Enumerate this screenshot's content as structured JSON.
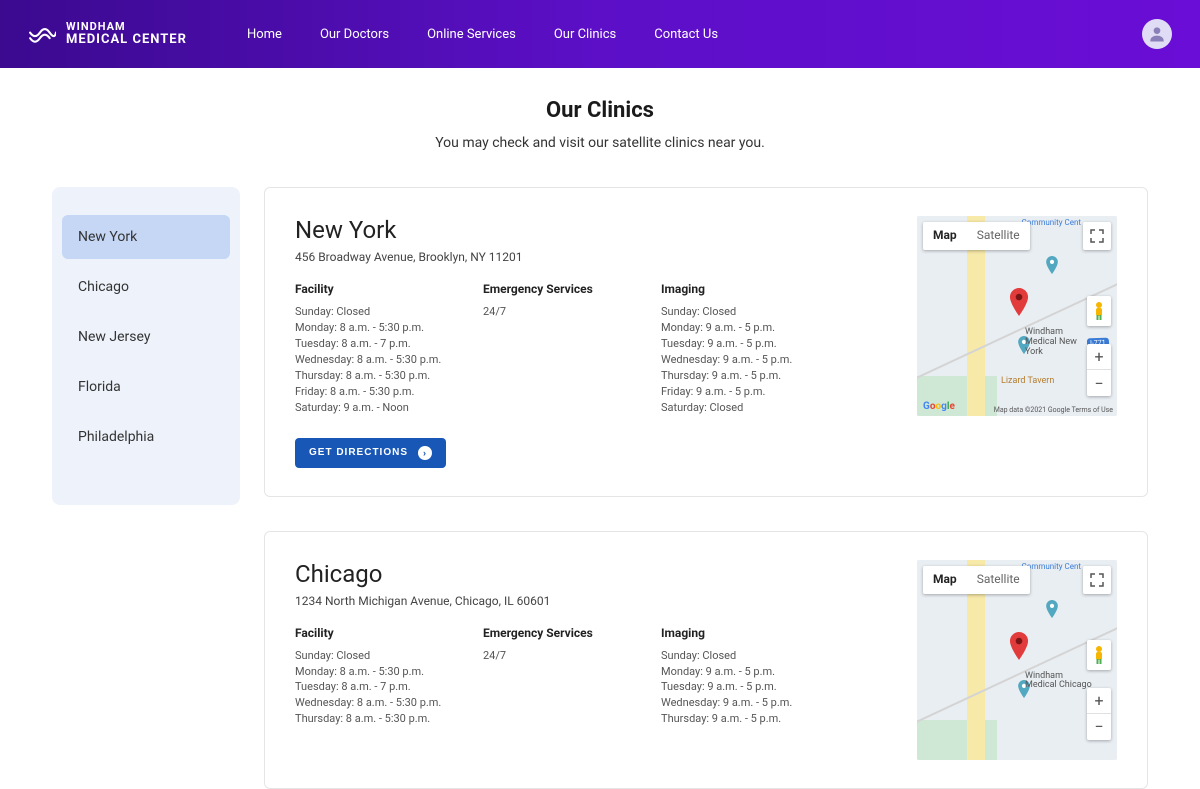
{
  "brand": {
    "line1": "WINDHAM",
    "line2": "MEDICAL CENTER"
  },
  "nav": {
    "home": "Home",
    "doctors": "Our Doctors",
    "online": "Online Services",
    "clinics": "Our Clinics",
    "contact": "Contact Us"
  },
  "page": {
    "title": "Our Clinics",
    "subtitle": "You may check and visit our satellite clinics near you."
  },
  "sidebar": {
    "items": [
      "New York",
      "Chicago",
      "New Jersey",
      "Florida",
      "Philadelphia"
    ],
    "activeIndex": 0
  },
  "labels": {
    "facility": "Facility",
    "emergency": "Emergency Services",
    "imaging": "Imaging",
    "directions": "GET DIRECTIONS"
  },
  "map": {
    "mapLabel": "Map",
    "satLabel": "Satellite",
    "zoomIn": "+",
    "zoomOut": "−",
    "community": "Community Cent",
    "clinicPrefix": "Windham Medical",
    "tavern": "Lizard Tavern",
    "iwy": "I-771",
    "copy": "Map data ©2021 Google   Terms of Use"
  },
  "clinics": [
    {
      "name": "New York",
      "address": "456 Broadway Avenue, Brooklyn, NY 11201",
      "facility": [
        "Sunday: Closed",
        "Monday: 8 a.m. - 5:30 p.m.",
        "Tuesday: 8 a.m. - 7 p.m.",
        "Wednesday: 8 a.m. - 5:30 p.m.",
        "Thursday: 8 a.m. - 5:30 p.m.",
        "Friday: 8 a.m. - 5:30 p.m.",
        "Saturday: 9 a.m. - Noon"
      ],
      "emergency": "24/7",
      "imaging": [
        "Sunday: Closed",
        "Monday: 9 a.m. - 5 p.m.",
        "Tuesday: 9 a.m. - 5 p.m.",
        "Wednesday: 9 a.m. - 5 p.m.",
        "Thursday: 9 a.m. - 5 p.m.",
        "Friday: 9 a.m. - 5 p.m.",
        "Saturday: Closed"
      ],
      "mapCity": "New York"
    },
    {
      "name": "Chicago",
      "address": "1234 North Michigan Avenue, Chicago, IL 60601",
      "facility": [
        "Sunday: Closed",
        "Monday: 8 a.m. - 5:30 p.m.",
        "Tuesday: 8 a.m. - 7 p.m.",
        "Wednesday: 8 a.m. - 5:30 p.m.",
        "Thursday: 8 a.m. - 5:30 p.m."
      ],
      "emergency": "24/7",
      "imaging": [
        "Sunday: Closed",
        "Monday: 9 a.m. - 5 p.m.",
        "Tuesday: 9 a.m. - 5 p.m.",
        "Wednesday: 9 a.m. - 5 p.m.",
        "Thursday: 9 a.m. - 5 p.m."
      ],
      "mapCity": "Chicago"
    }
  ]
}
